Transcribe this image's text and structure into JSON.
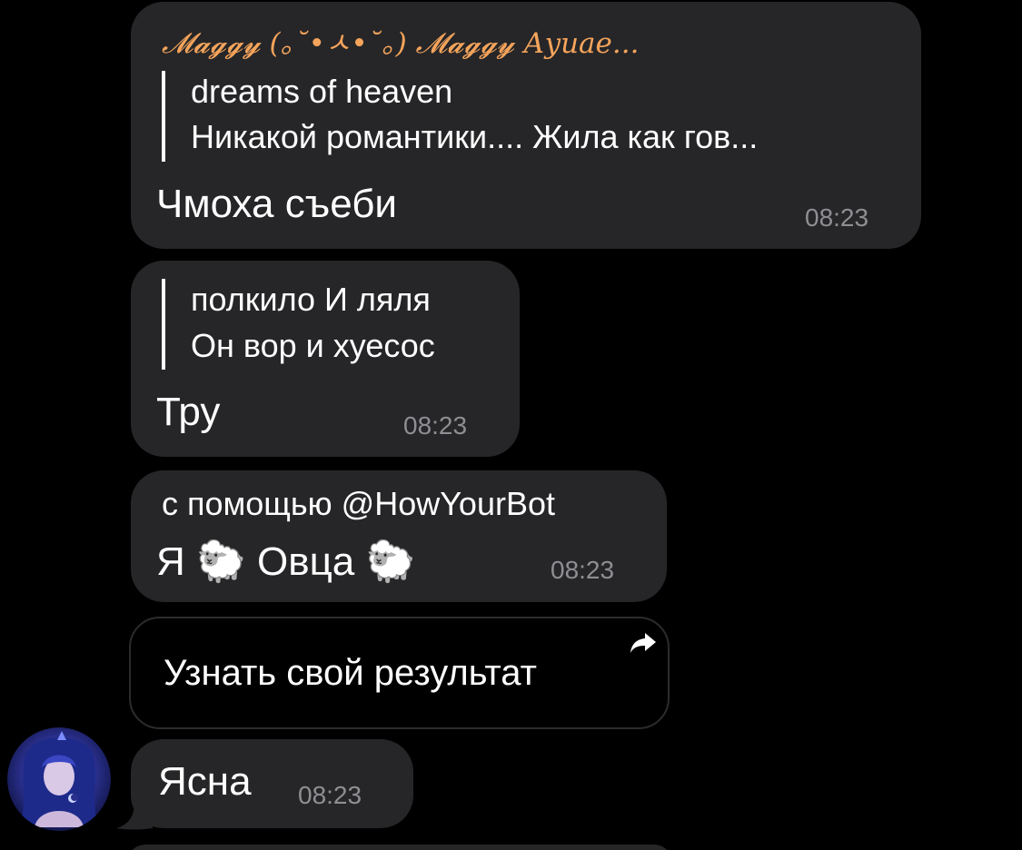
{
  "messages": [
    {
      "sender": "𝓜𝓪𝓰𝓰𝔂 (｡˘•ㅅ•˘｡) 𝓜𝓪𝓰𝓰𝔂 Аyuae...",
      "reply_title": "dreams of heaven",
      "reply_text": "Никакой романтики.... Жила как гов...",
      "text": "Чмоха съеби",
      "time": "08:23"
    },
    {
      "reply_title": "полкило И ляля",
      "reply_text": "Он вор и хуесос",
      "text": "Тру",
      "time": "08:23"
    },
    {
      "via": "с помощью @HowYourBot",
      "text": "Я 🐑 Овца 🐑",
      "time": "08:23"
    },
    {
      "text": "Ясна",
      "time": "08:23"
    }
  ],
  "inline_button": {
    "label": "Узнать свой результат",
    "icon": "share-arrow-icon"
  },
  "avatar": {
    "icon": "user-avatar"
  },
  "colors": {
    "background": "#000000",
    "bubble": "#262628",
    "sender": "#f5a45b",
    "time": "#8e8e93",
    "text": "#ffffff"
  }
}
